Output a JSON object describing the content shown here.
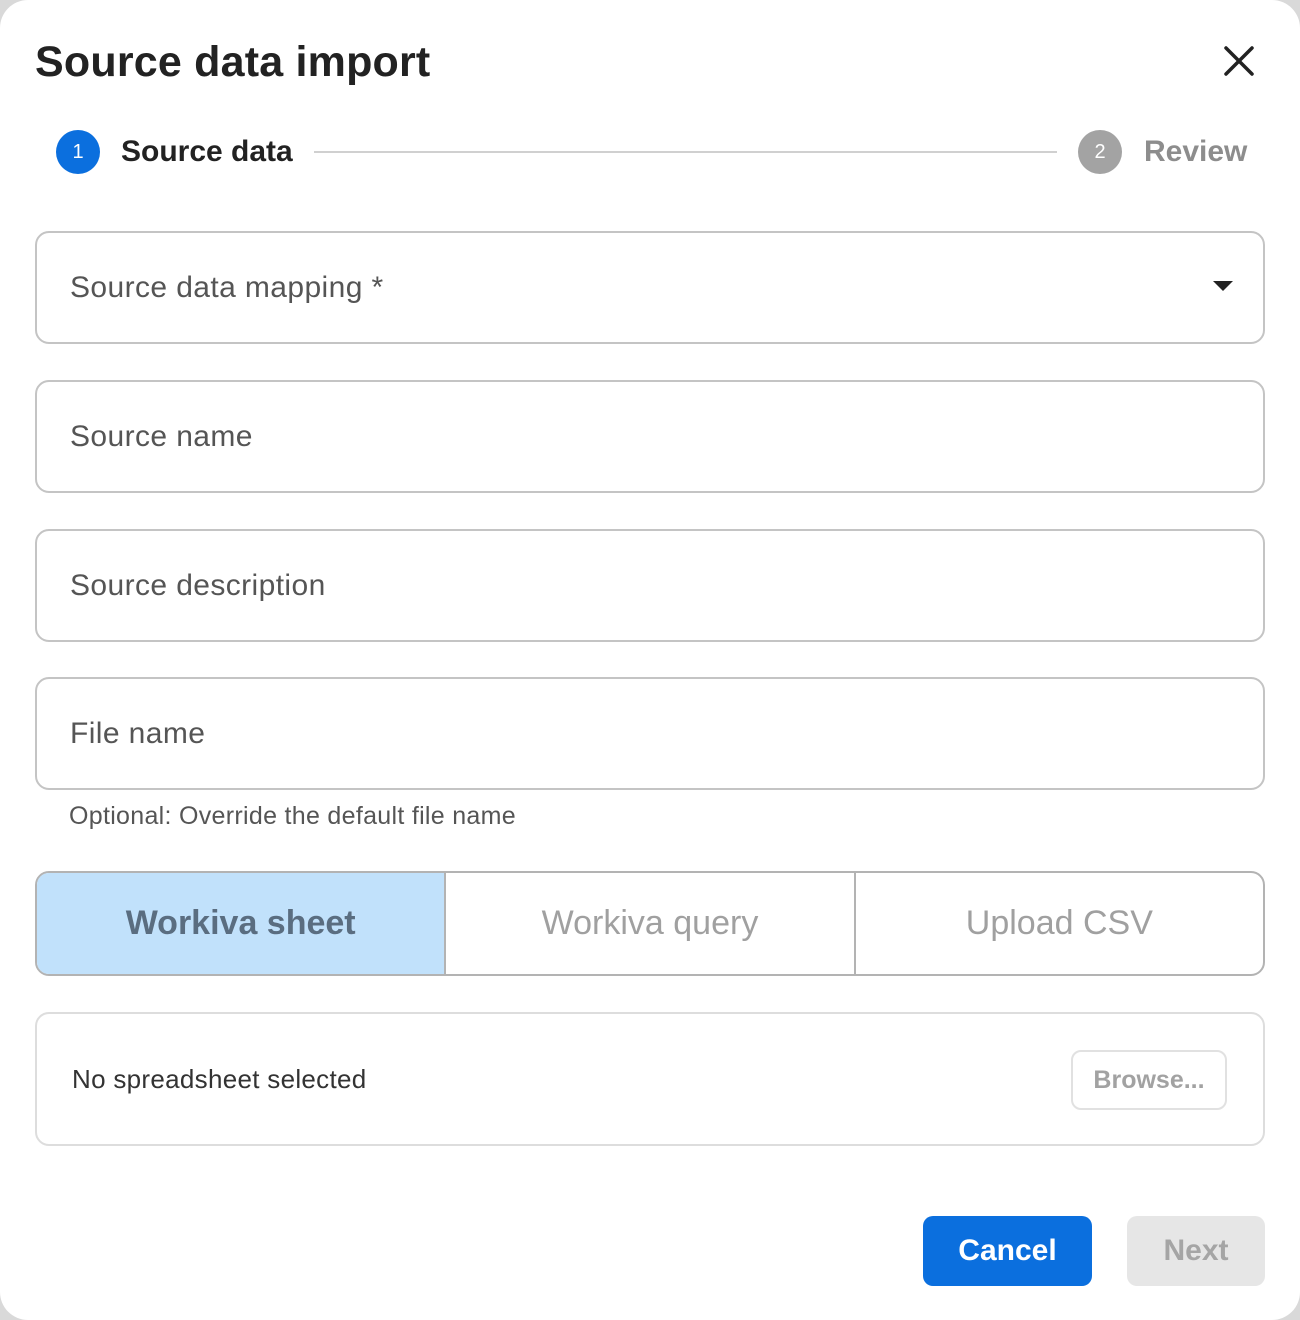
{
  "dialog": {
    "title": "Source data import",
    "close_icon": "close-icon"
  },
  "stepper": {
    "steps": [
      {
        "number": "1",
        "label": "Source data",
        "state": "active"
      },
      {
        "number": "2",
        "label": "Review",
        "state": "inactive"
      }
    ]
  },
  "form": {
    "mapping": {
      "placeholder": "Source data mapping *",
      "icon": "caret-down-icon"
    },
    "source_name": {
      "placeholder": "Source name"
    },
    "source_description": {
      "placeholder": "Source description"
    },
    "file_name": {
      "placeholder": "File name",
      "helper": "Optional: Override the default file name"
    }
  },
  "source_type": {
    "options": [
      "Workiva sheet",
      "Workiva query",
      "Upload CSV"
    ],
    "selected": "Workiva sheet"
  },
  "file_picker": {
    "status": "No spreadsheet selected",
    "browse_label": "Browse..."
  },
  "footer": {
    "cancel_label": "Cancel",
    "next_label": "Next"
  },
  "colors": {
    "accent": "#0b6fde",
    "selected_segment": "#c1e1fb",
    "disabled": "#e6e6e6"
  }
}
